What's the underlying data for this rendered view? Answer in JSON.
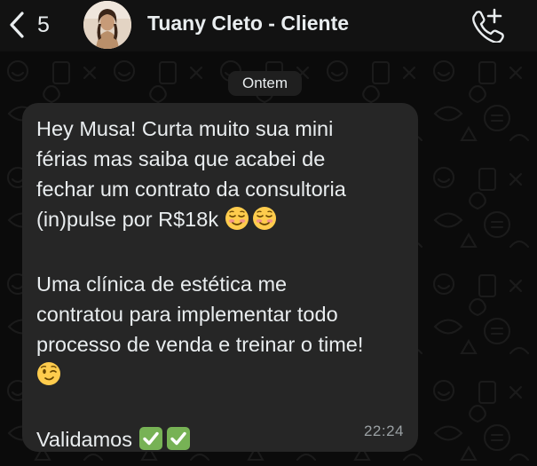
{
  "header": {
    "back_count": "5",
    "contact_name": "Tuany Cleto - Cliente"
  },
  "chat": {
    "date_separator": "Ontem",
    "message": {
      "line1": "Hey Musa! Curta muito sua mini",
      "line2": "férias mas saiba que acabei de",
      "line3": "fechar um contrato da consultoria",
      "line4": "(in)pulse por R$18k",
      "line5": "Uma clínica de estética me",
      "line6": "contratou para implementar todo",
      "line7": "processo de venda e treinar o time!",
      "line9": "Validamos",
      "time": "22:24"
    }
  },
  "icons": {
    "back": "chevron-left-icon",
    "call": "phone-plus-icon",
    "smiling": "smiling-face-emoji",
    "wink": "winking-face-emoji",
    "check": "check-mark-button-emoji"
  },
  "colors": {
    "header_bg": "#121212",
    "bubble_bg": "#262626",
    "text": "#e9edef",
    "timestamp": "#9aa0a3",
    "check_green": "#77b255"
  }
}
